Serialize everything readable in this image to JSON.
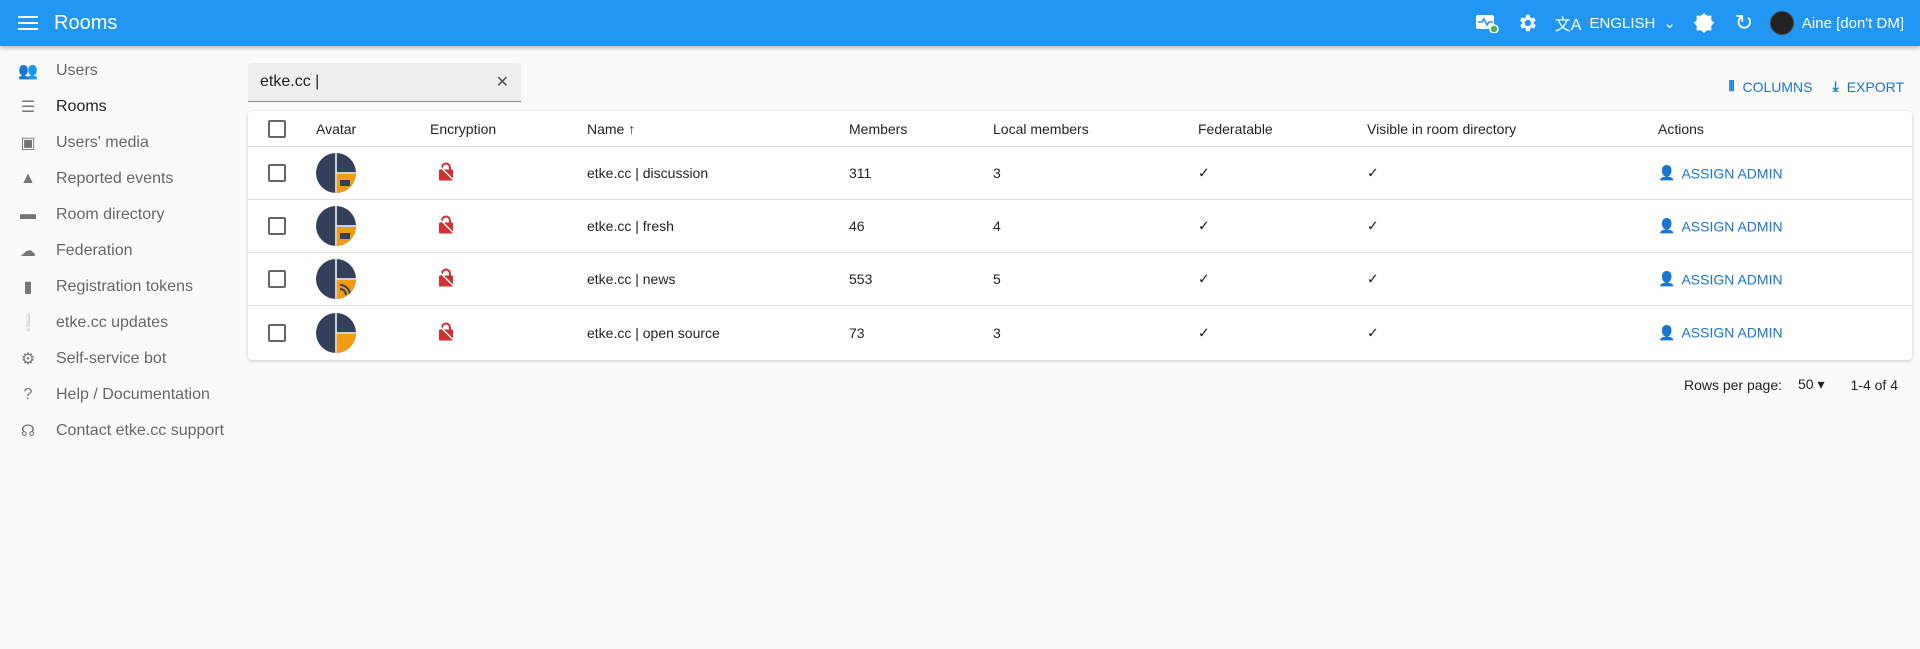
{
  "appbar": {
    "title": "Rooms",
    "language": "ENGLISH",
    "user": "Aine [don't DM]"
  },
  "sidebar": {
    "items": [
      {
        "label": "Users",
        "icon": "users-icon"
      },
      {
        "label": "Rooms",
        "icon": "list-icon"
      },
      {
        "label": "Users' media",
        "icon": "photo-library-icon"
      },
      {
        "label": "Reported events",
        "icon": "warning-icon"
      },
      {
        "label": "Room directory",
        "icon": "folder-shared-icon"
      },
      {
        "label": "Federation",
        "icon": "cloud-icon"
      },
      {
        "label": "Registration tokens",
        "icon": "ticket-icon"
      },
      {
        "label": "etke.cc updates",
        "icon": "feedback-icon"
      },
      {
        "label": "Self-service bot",
        "icon": "engineering-icon"
      },
      {
        "label": "Help / Documentation",
        "icon": "help-icon"
      },
      {
        "label": "Contact etke.cc support",
        "icon": "support-agent-icon"
      }
    ]
  },
  "search": {
    "value": "etke.cc |"
  },
  "toolbar": {
    "columns": "COLUMNS",
    "export": "EXPORT"
  },
  "table": {
    "headers": [
      "Avatar",
      "Encryption",
      "Name",
      "Members",
      "Local members",
      "Federatable",
      "Visible in room directory",
      "Actions"
    ],
    "rows": [
      {
        "name": "etke.cc | discussion",
        "members": "311",
        "local": "3",
        "federatable": "✓",
        "visible": "✓",
        "action": "ASSIGN ADMIN",
        "avatar_icon": "cup"
      },
      {
        "name": "etke.cc | fresh",
        "members": "46",
        "local": "4",
        "federatable": "✓",
        "visible": "✓",
        "action": "ASSIGN ADMIN",
        "avatar_icon": "cup"
      },
      {
        "name": "etke.cc | news",
        "members": "553",
        "local": "5",
        "federatable": "✓",
        "visible": "✓",
        "action": "ASSIGN ADMIN",
        "avatar_icon": "rss"
      },
      {
        "name": "etke.cc | open source",
        "members": "73",
        "local": "3",
        "federatable": "✓",
        "visible": "✓",
        "action": "ASSIGN ADMIN",
        "avatar_icon": "none"
      }
    ]
  },
  "pagination": {
    "rows_label": "Rows per page:",
    "rows_value": "50",
    "range": "1-4 of 4"
  },
  "colors": {
    "primary": "#2196f3",
    "link": "#1976d2",
    "unencrypted": "#d32f2f",
    "avatar_dark": "#34405a",
    "avatar_accent": "#f39c12"
  }
}
